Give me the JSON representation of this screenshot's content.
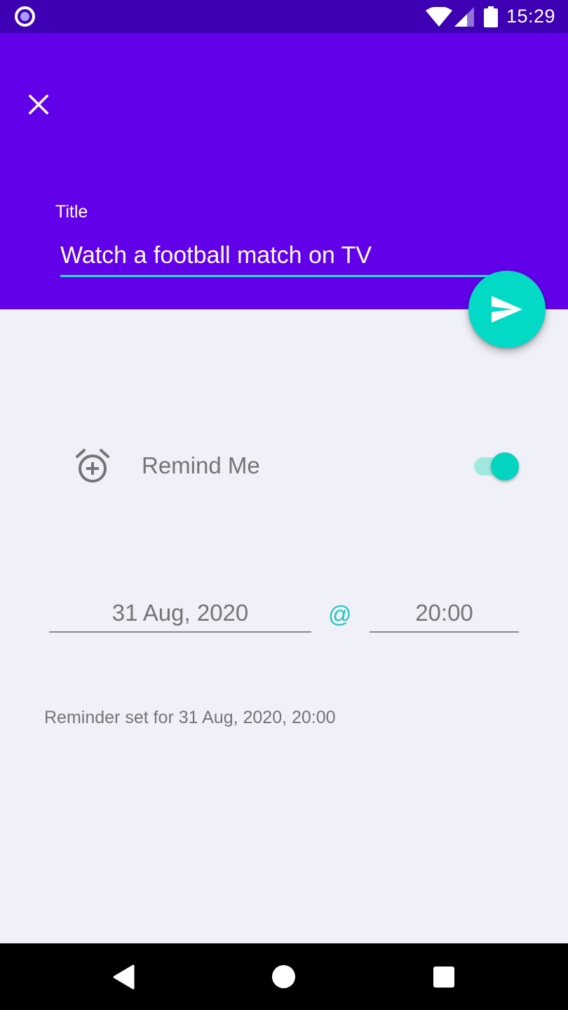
{
  "status_bar": {
    "time": "15:29",
    "icons": [
      "app-notification-icon",
      "wifi-icon",
      "signal-icon",
      "battery-icon"
    ]
  },
  "header": {
    "close_icon": "close-icon",
    "title_label": "Title",
    "title_value": "Watch a football match on TV"
  },
  "fab": {
    "icon": "send-icon"
  },
  "reminder": {
    "icon": "alarm-add-icon",
    "label": "Remind Me",
    "enabled": true
  },
  "schedule": {
    "date": "31 Aug, 2020",
    "separator": "@",
    "time": "20:00",
    "status_text": "Reminder set for 31 Aug, 2020, 20:00"
  },
  "nav_bar": {
    "icons": [
      "back-icon",
      "home-icon",
      "recents-icon"
    ]
  },
  "colors": {
    "status_bar": "#3d00b3",
    "header": "#6200ea",
    "accent": "#03dac5",
    "background": "#eff0f8",
    "secondary_text": "#757575"
  }
}
